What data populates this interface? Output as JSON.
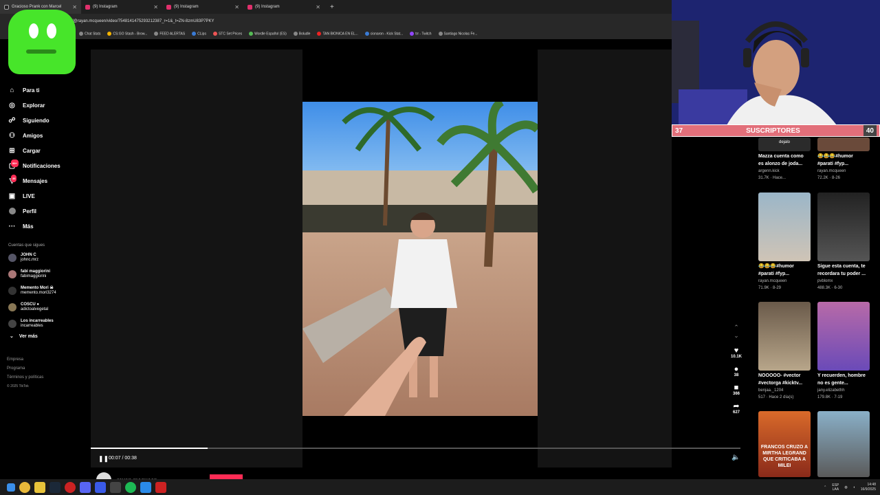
{
  "browser": {
    "tabs": [
      {
        "title": "Gracioso Prank con Marcel"
      },
      {
        "title": "(9) Instagram"
      },
      {
        "title": "(9) Instagram"
      },
      {
        "title": "(9) Instagram"
      }
    ],
    "new_tab": "+",
    "url": "m/@rayan.mcqueen/video/7548141475293212387_r=1&_t=ZN-8zmU83P7PKY",
    "bookmarks": [
      "Chat Stats",
      "CS:GO Stash - Brow...",
      "FEED ALERTAS",
      "CLips",
      "STC Set Prices",
      "Wordle Español (ES)",
      "Boludle",
      "TAN BIONICA EN EL...",
      "cionaron - Kick Stat...",
      "trr - Twitch",
      "Santiago Nicolas Fe..."
    ]
  },
  "sidebar": {
    "nav": [
      {
        "label": "Para ti",
        "icon": "home-icon"
      },
      {
        "label": "Explorar",
        "icon": "compass-icon"
      },
      {
        "label": "Siguiendo",
        "icon": "following-icon"
      },
      {
        "label": "Amigos",
        "icon": "friends-icon"
      },
      {
        "label": "Cargar",
        "icon": "upload-icon"
      },
      {
        "label": "Notificaciones",
        "icon": "bell-icon",
        "badge": "99+"
      },
      {
        "label": "Mensajes",
        "icon": "message-icon",
        "badge": "38"
      },
      {
        "label": "LIVE",
        "icon": "live-icon"
      },
      {
        "label": "Perfil",
        "icon": "profile-icon"
      },
      {
        "label": "Más",
        "icon": "more-icon"
      }
    ],
    "following_title": "Cuentas que sigues",
    "following": [
      {
        "name": "JOHN C",
        "handle": "johnc.mrz"
      },
      {
        "name": "fabi maggiorini",
        "handle": "fabimaggiorini"
      },
      {
        "name": "Memento Mori ☠",
        "handle": "memento.mori3274"
      },
      {
        "name": "COSCU ●",
        "handle": "adictoalvegetal"
      },
      {
        "name": "Los incarreables",
        "handle": "incarreables"
      }
    ],
    "ver_mas": "Ver más",
    "footer": [
      "Empresa",
      "Programa",
      "Términos y políticas"
    ],
    "copyright": "© 2025 TikTok"
  },
  "player": {
    "current_time": "00:07",
    "duration": "00:38",
    "time_text": "00:07 / 00:38",
    "progress": 0.18,
    "author": "rayan.mcqueen"
  },
  "actions": {
    "likes": "10.1K",
    "comments": "38",
    "saves": "366",
    "shares": "627"
  },
  "stream_overlay": {
    "sub_left": "37",
    "sub_label": "SUSCRIPTORES",
    "sub_right": "40"
  },
  "related": [
    {
      "caption": "Mazza cuenta como",
      "caption2": "es alonzo de joda...",
      "author": "argenn.kick",
      "stats": "31.7K · Hace...",
      "thumb_text": "dejalo"
    },
    {
      "caption": "😂😂😂#humor",
      "caption2": "#parati #fyp...",
      "author": "rayan.mcqueen",
      "stats": "72.2K · 8-26",
      "thumb_text": ""
    },
    {
      "caption": "😂😂😂#humor",
      "caption2": "#parati #fyp...",
      "author": "rayan.mcqueen",
      "stats": "71.9K · 8-29",
      "thumb_text": ""
    },
    {
      "caption": "Sigue esta cuenta, te",
      "caption2": "recordara tu poder ...",
      "author": "pvblomx",
      "stats": "488.3K · 6-30",
      "thumb_text": ""
    },
    {
      "caption": "NOOOOO- #vector",
      "caption2": "#vectorga #kicktv...",
      "author": "benjaa._1204",
      "stats": "517 · Hace 2 día(s)",
      "thumb_text": ""
    },
    {
      "caption": "Y recuerden, hombre",
      "caption2": "no es gente...",
      "author": "jany.elizabethh",
      "stats": "179.8K · 7-19",
      "thumb_text": ""
    },
    {
      "caption": "",
      "caption2": "",
      "author": "",
      "stats": "",
      "thumb_text": "FRANCOS CRUZO A MIRTHA LEGRAND QUE CRITICABA A MILEI"
    },
    {
      "caption": "",
      "caption2": "",
      "author": "",
      "stats": "",
      "thumb_text": ""
    }
  ],
  "taskbar": {
    "lang": "ESP",
    "lang2": "LAA",
    "time": "14:48",
    "date": "16/9/2025"
  }
}
